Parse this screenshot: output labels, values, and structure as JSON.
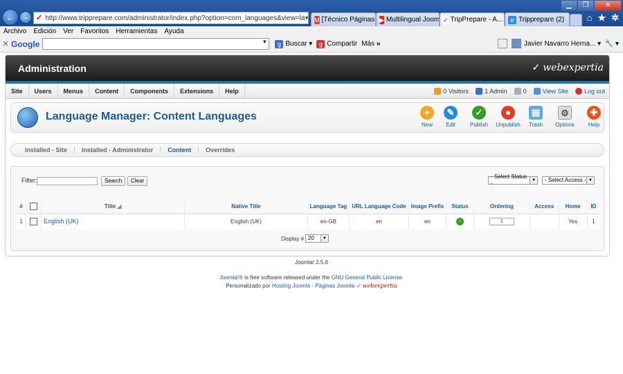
{
  "browser": {
    "url": "http://www.tripprepare.com/administrator/index.php?option=com_languages&view=la",
    "tabs": [
      {
        "label": "[Técnico Páginas ..."
      },
      {
        "label": "Multilingual Joom..."
      },
      {
        "label": "TripPrepare - A..."
      },
      {
        "label": "Tripprepare (2)"
      }
    ],
    "menu": [
      "Archivo",
      "Edición",
      "Ver",
      "Favoritos",
      "Herramientas",
      "Ayuda"
    ],
    "google_toolbar": {
      "logo": "Google",
      "buscar": "Buscar",
      "compartir": "Compartir",
      "mas": "Más",
      "user": "Javier Navarro Herna..."
    }
  },
  "admin": {
    "title": "Administration",
    "brand": "webexpertia",
    "nav": [
      "Site",
      "Users",
      "Menus",
      "Content",
      "Components",
      "Extensions",
      "Help"
    ],
    "status": {
      "visitors": "0 Visitors",
      "admins": "1 Admin",
      "messages": "0",
      "view_site": "View Site",
      "logout": "Log out"
    }
  },
  "toolbar": {
    "page_title": "Language Manager: Content Languages",
    "buttons": {
      "new": "New",
      "edit": "Edit",
      "publish": "Publish",
      "unpublish": "Unpublish",
      "trash": "Trash",
      "options": "Options",
      "help": "Help"
    }
  },
  "subtabs": [
    "Installed - Site",
    "Installed - Administrator",
    "Content",
    "Overrides"
  ],
  "filter": {
    "label": "Filter:",
    "value": "",
    "search": "Search",
    "clear": "Clear",
    "status_select": "- Select Status -",
    "access_select": "- Select Access -"
  },
  "table": {
    "headers": {
      "num": "#",
      "title": "Title",
      "native_title": "Native Title",
      "language_tag": "Language Tag",
      "url_code": "URL Language Code",
      "image_prefix": "Image Prefix",
      "status": "Status",
      "ordering": "Ordering",
      "access": "Access",
      "home": "Home",
      "id": "ID"
    },
    "rows": [
      {
        "num": "1",
        "title": "English (UK)",
        "native_title": "English (UK)",
        "language_tag": "en-GB",
        "url_code": "en",
        "image_prefix": "en",
        "status": "published",
        "ordering": "1",
        "access": "",
        "home": "Yes",
        "id": "1"
      }
    ],
    "display_label": "Display #",
    "display_value": "20"
  },
  "footer": {
    "version": "Joomla! 2.5.6",
    "license_prefix": "Joomla!®",
    "license_mid": "is free software released under the",
    "license_link": "GNU General Public License.",
    "custom_prefix": "Personalizado por",
    "custom_link": "Hosting Joomla - Páginas Joomla",
    "custom_brand": "webexpertia"
  }
}
